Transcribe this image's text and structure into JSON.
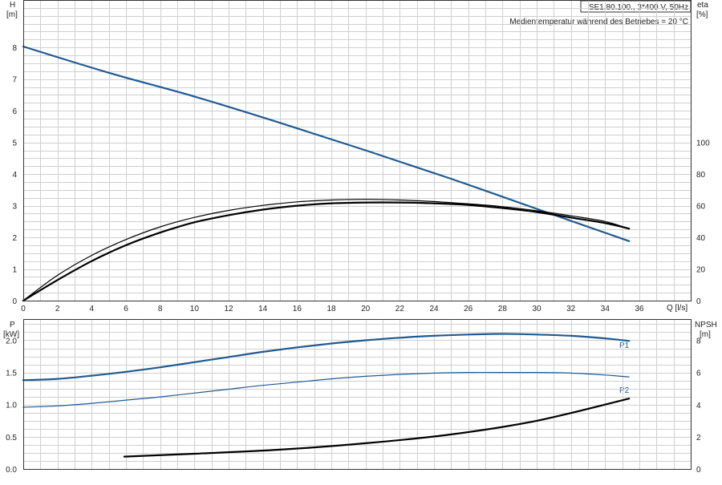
{
  "chart_data": [
    {
      "type": "line",
      "panel": "upper",
      "title": "SE1.80.100., 3*400 V, 50Hz",
      "subtitle": "Medientemperatur während des Betriebes = 20 °C",
      "xlabel": "Q [l/s]",
      "ylabel": "H",
      "ylabel_unit": "[m]",
      "y2label": "eta",
      "y2label_unit": "[%]",
      "xlim": [
        0,
        39
      ],
      "ylim": [
        0,
        9.5
      ],
      "y2lim": [
        0,
        190
      ],
      "xticks": [
        "0",
        "2",
        "4",
        "6",
        "8",
        "10",
        "12",
        "14",
        "16",
        "18",
        "20",
        "22",
        "24",
        "26",
        "28",
        "30",
        "32",
        "34",
        "36"
      ],
      "yticks": [
        "0",
        "1",
        "2",
        "3",
        "4",
        "5",
        "6",
        "7",
        "8"
      ],
      "y2ticks": [
        "0",
        "20",
        "40",
        "60",
        "80",
        "100"
      ],
      "series": [
        {
          "name": "",
          "axis": "left",
          "color": "#1f5a92",
          "x": [
            0,
            5,
            10,
            15,
            20,
            25,
            30,
            35.4
          ],
          "y": [
            8.03,
            7.2,
            6.45,
            5.62,
            4.75,
            3.85,
            2.9,
            1.88
          ]
        },
        {
          "name": "",
          "axis": "right",
          "color": "#000000",
          "x": [
            0,
            2,
            4,
            6,
            8,
            10,
            12,
            14,
            16,
            18,
            20,
            22,
            24,
            26,
            28,
            30,
            32,
            34,
            35.4
          ],
          "y": [
            0,
            13,
            25,
            35,
            43,
            49.5,
            54,
            57.5,
            60,
            61.5,
            62,
            62,
            61.5,
            60.5,
            58.5,
            56,
            52.5,
            49,
            45.5
          ]
        },
        {
          "name": "",
          "axis": "left",
          "color": "#000000",
          "thin": true,
          "x": [
            0,
            2,
            4,
            6,
            8,
            10,
            12,
            14,
            16,
            18,
            20,
            22,
            24,
            26,
            28,
            30,
            32,
            34,
            35.4
          ],
          "y": [
            0,
            0.8,
            1.43,
            1.93,
            2.33,
            2.63,
            2.85,
            3.01,
            3.12,
            3.18,
            3.2,
            3.18,
            3.13,
            3.06,
            2.97,
            2.84,
            2.68,
            2.5,
            2.27
          ]
        }
      ]
    },
    {
      "type": "line",
      "panel": "lower",
      "ylabel": "P",
      "ylabel_unit": "[kW]",
      "y2label": "NPSH",
      "y2label_unit": "[m]",
      "xlim": [
        0,
        39
      ],
      "ylim": [
        0,
        2.33
      ],
      "y2lim": [
        0,
        9.33
      ],
      "yticks": [
        "0.0",
        "0.5",
        "1.0",
        "1.5",
        "2.0"
      ],
      "y2ticks": [
        "0",
        "2",
        "4",
        "6",
        "8"
      ],
      "series": [
        {
          "name": "P1",
          "axis": "left",
          "color": "#1f5a92",
          "x": [
            0,
            2,
            4,
            6,
            8,
            10,
            12,
            14,
            16,
            18,
            20,
            22,
            24,
            26,
            28,
            30,
            32,
            34,
            35.4
          ],
          "y": [
            1.38,
            1.4,
            1.45,
            1.51,
            1.58,
            1.66,
            1.74,
            1.82,
            1.89,
            1.95,
            2.0,
            2.04,
            2.07,
            2.09,
            2.1,
            2.09,
            2.07,
            2.03,
            1.99
          ]
        },
        {
          "name": "P2",
          "axis": "left",
          "color": "#1f5a92",
          "thin": true,
          "x": [
            0,
            2,
            4,
            6,
            8,
            10,
            12,
            14,
            16,
            18,
            20,
            22,
            24,
            26,
            28,
            30,
            32,
            34,
            35.4
          ],
          "y": [
            0.96,
            0.98,
            1.02,
            1.07,
            1.12,
            1.18,
            1.24,
            1.3,
            1.35,
            1.4,
            1.44,
            1.47,
            1.49,
            1.5,
            1.5,
            1.5,
            1.49,
            1.46,
            1.43
          ]
        },
        {
          "name": "",
          "axis": "right",
          "color": "#000000",
          "x": [
            5.9,
            10,
            15,
            20,
            25,
            30,
            35.4
          ],
          "y": [
            0.77,
            0.95,
            1.2,
            1.6,
            2.15,
            3.0,
            4.38
          ]
        }
      ]
    }
  ]
}
